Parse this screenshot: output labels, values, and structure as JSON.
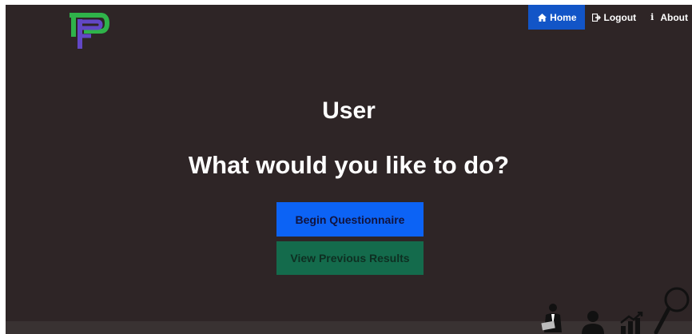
{
  "nav": {
    "home_label": "Home",
    "logout_label": "Logout",
    "about_label": "About",
    "about_icon_glyph": "i"
  },
  "main": {
    "user_name": "User",
    "prompt": "What would you like to do?",
    "begin_label": "Begin Questionnaire",
    "results_label": "View Previous Results"
  },
  "colors": {
    "background": "#2e2526",
    "nav_active": "#1255c7",
    "begin_button": "#0c63f5",
    "results_button": "#146b4c",
    "logo_green": "#2fb34a",
    "logo_purple": "#6247c6"
  }
}
